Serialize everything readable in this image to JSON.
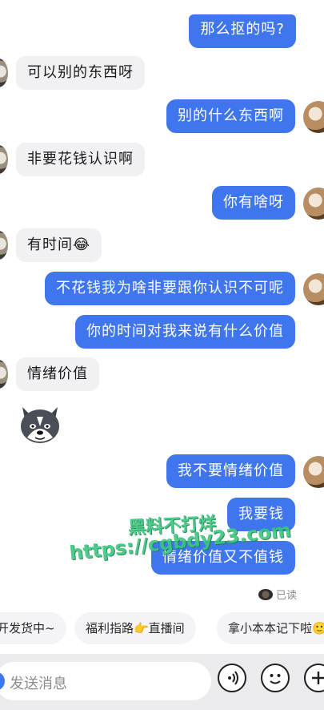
{
  "messages": [
    {
      "side": "out",
      "text": "那么抠的吗?"
    },
    {
      "side": "in",
      "text": "可以别的东西呀"
    },
    {
      "side": "out",
      "text": "别的什么东西啊"
    },
    {
      "side": "in",
      "text": "非要花钱认识啊"
    },
    {
      "side": "out",
      "text": "你有啥呀"
    },
    {
      "side": "in",
      "text": "有时间😂"
    },
    {
      "side": "out",
      "text": "不花钱我为啥非要跟你认识不可呢"
    },
    {
      "side": "out",
      "text": "你的时间对我来说有什么价值"
    },
    {
      "side": "in",
      "text": "情绪价值"
    },
    {
      "side": "out",
      "text": "我不要情绪价值"
    },
    {
      "side": "out",
      "text": "我要钱"
    },
    {
      "side": "out",
      "text": "情绪价值又不值钱"
    }
  ],
  "read_receipt": "已读",
  "watermark": {
    "line1": "黑料不打烊",
    "line2": "https://cgbdy23.com"
  },
  "quick_replies": [
    "开发货中~",
    "福利指路👉直播间",
    "拿小本本记下啦🙂"
  ],
  "composer": {
    "placeholder": "发送消息"
  },
  "icons": {
    "voice": "voice-icon",
    "emoji": "emoji-icon",
    "add": "add-icon",
    "sticker": "husky-sticker-icon"
  },
  "colors": {
    "outgoing_bubble": "#3f76ee",
    "incoming_bubble": "#f1f1f3",
    "watermark": "#3bc77f"
  }
}
